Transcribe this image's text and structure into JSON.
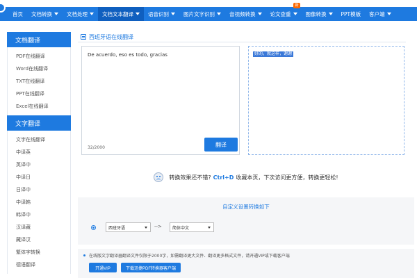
{
  "nav": {
    "items": [
      {
        "label": "首页",
        "caret": false,
        "active": false
      },
      {
        "label": "文档转换",
        "caret": true,
        "active": false
      },
      {
        "label": "文档处理",
        "caret": true,
        "active": false
      },
      {
        "label": "文档文本翻译",
        "caret": true,
        "active": true
      },
      {
        "label": "语音识别",
        "caret": true,
        "active": false
      },
      {
        "label": "图片文字识别",
        "caret": true,
        "active": false
      },
      {
        "label": "音视频转换",
        "caret": true,
        "active": false
      },
      {
        "label": "论文查重",
        "caret": true,
        "active": false,
        "badge": "新"
      },
      {
        "label": "图像转换",
        "caret": true,
        "active": false
      },
      {
        "label": "PPT模板",
        "caret": false,
        "active": false
      },
      {
        "label": "客户端",
        "caret": true,
        "active": false
      }
    ]
  },
  "sidebar": {
    "doc_head": "文档翻译",
    "doc_items": [
      "PDF在线翻译",
      "Word在线翻译",
      "TXT在线翻译",
      "PPT在线翻译",
      "Excel在线翻译"
    ],
    "text_head": "文字翻译",
    "text_items": [
      "文字在线翻译",
      "中译英",
      "英译中",
      "中译日",
      "日译中",
      "中译韩",
      "韩译中",
      "汉译藏",
      "藏译汉",
      "繁体字转换",
      "德语翻译"
    ]
  },
  "main": {
    "title": "西班牙语在线翻译",
    "source_text": "De acuerdo, eso es todo, gracias",
    "char_count": "32/2000",
    "translate_button": "翻译",
    "result_text": "好的，就这样，谢谢",
    "tip_prefix": "转换效果还不错?",
    "tip_key": "Ctrl+D",
    "tip_suffix": "收藏本页，下次访问更方便，转换更轻松!",
    "custom_title": "自定义设置转换如下",
    "source_lang": "西班牙语",
    "arrow": "-->",
    "target_lang": "简体中文",
    "notice": "在线版文字翻译器翻译文件仅限于2000字，如需翻译更大文件、翻译更多格式文件，请开通VIP或下载客户端",
    "vip_button": "开通VIP",
    "pdf_button": "下载迅捷PDF转换器客户端"
  },
  "colors": {
    "accent": "#1e7ae0"
  }
}
